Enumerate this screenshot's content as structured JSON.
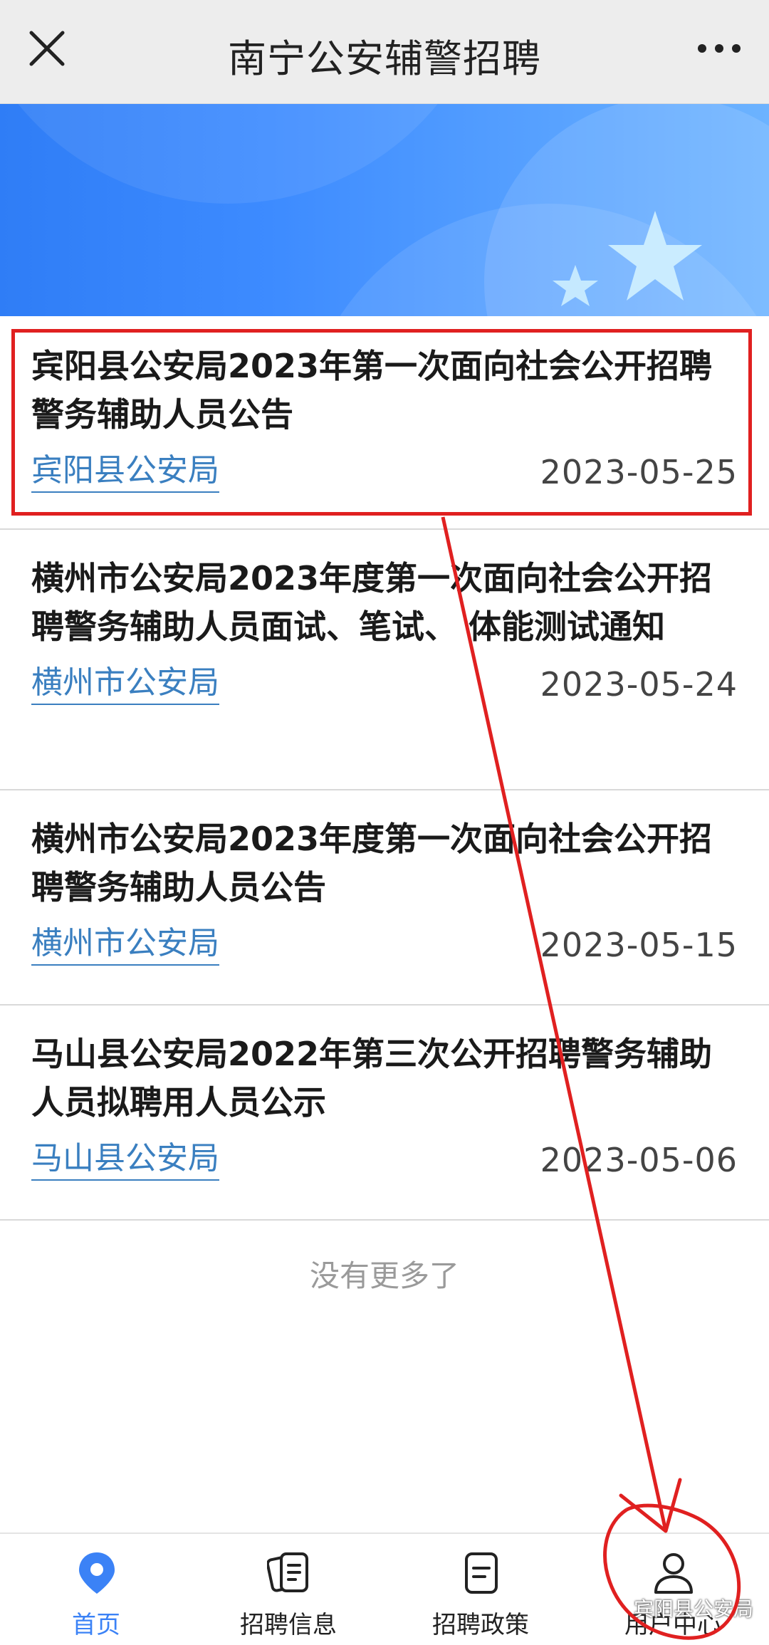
{
  "topbar": {
    "title": "南宁公安辅警招聘",
    "close_icon": "close-icon",
    "more_icon": "more-icon"
  },
  "colors": {
    "accent": "#3b82f6",
    "org_link": "#3a7fc0",
    "highlight": "#e02020"
  },
  "list": {
    "items": [
      {
        "title": "宾阳县公安局2023年第一次面向社会公开招聘警务辅助人员公告",
        "org": "宾阳县公安局",
        "date": "2023-05-25"
      },
      {
        "title": "横州市公安局2023年度第一次面向社会公开招聘警务辅助人员面试、笔试、 体能测试通知",
        "org": "横州市公安局",
        "date": "2023-05-24"
      },
      {
        "title": "横州市公安局2023年度第一次面向社会公开招聘警务辅助人员公告",
        "org": "横州市公安局",
        "date": "2023-05-15"
      },
      {
        "title": "马山县公安局2022年第三次公开招聘警务辅助人员拟聘用人员公示",
        "org": "马山县公安局",
        "date": "2023-05-06"
      }
    ],
    "end_text": "没有更多了"
  },
  "nav": {
    "tabs": [
      {
        "label": "首页",
        "icon": "location-pin-icon",
        "active": true
      },
      {
        "label": "招聘信息",
        "icon": "document-cards-icon",
        "active": false
      },
      {
        "label": "招聘政策",
        "icon": "policy-document-icon",
        "active": false
      },
      {
        "label": "用户中心",
        "icon": "user-icon",
        "active": false
      }
    ]
  },
  "watermark": "宾阳县公安局"
}
